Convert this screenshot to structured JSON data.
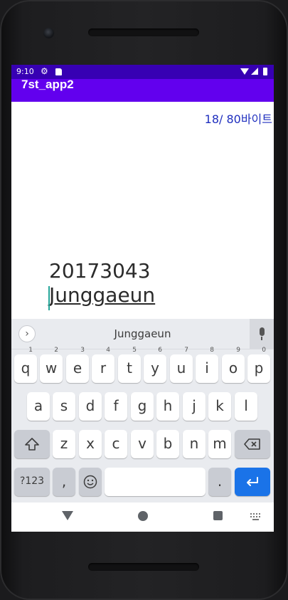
{
  "status_bar": {
    "time": "9:10"
  },
  "app_bar": {
    "title": "7st_app2"
  },
  "main": {
    "byte_counter": "18/ 80바이트",
    "edit_text": {
      "line1": "20173043",
      "line2": "Junggaeun"
    }
  },
  "keyboard": {
    "suggestion": "Junggaeun",
    "row1": [
      {
        "label": "q",
        "hint": "1"
      },
      {
        "label": "w",
        "hint": "2"
      },
      {
        "label": "e",
        "hint": "3"
      },
      {
        "label": "r",
        "hint": "4"
      },
      {
        "label": "t",
        "hint": "5"
      },
      {
        "label": "y",
        "hint": "6"
      },
      {
        "label": "u",
        "hint": "7"
      },
      {
        "label": "i",
        "hint": "8"
      },
      {
        "label": "o",
        "hint": "9"
      },
      {
        "label": "p",
        "hint": "0"
      }
    ],
    "row2": [
      "a",
      "s",
      "d",
      "f",
      "g",
      "h",
      "j",
      "k",
      "l"
    ],
    "row3": [
      "z",
      "x",
      "c",
      "v",
      "b",
      "n",
      "m"
    ],
    "symbols_key": "?123",
    "comma_key": ",",
    "period_key": "."
  },
  "icons": {
    "settings": "gear-icon",
    "sd_card": "sd-card-icon",
    "wifi": "wifi-icon",
    "cell": "cell-signal-icon",
    "battery": "battery-icon",
    "expand": "chevron-right-icon",
    "mic": "mic-icon",
    "shift": "shift-icon",
    "delete": "backspace-icon",
    "emoji": "emoji-icon",
    "enter": "enter-icon",
    "back": "back-icon",
    "home": "home-icon",
    "recents": "recents-icon",
    "keyboard_switch": "keyboard-switch-icon"
  },
  "colors": {
    "status_bar": "#3700b3",
    "app_bar": "#6200ee",
    "counter_text": "#1f2fbf",
    "enter_key": "#1a73e8",
    "cursor": "#26a69a"
  }
}
